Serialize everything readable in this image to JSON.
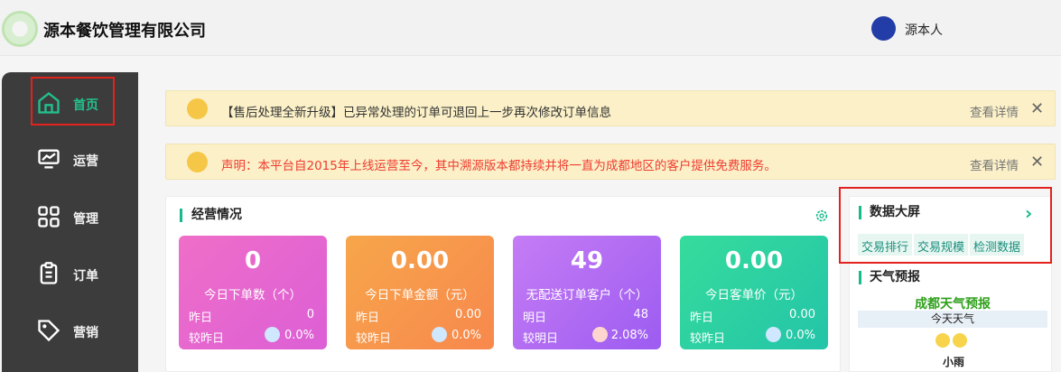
{
  "header": {
    "title": "源本餐饮管理有限公司",
    "user": "源本人"
  },
  "sidebar": {
    "items": [
      {
        "label": "首页",
        "icon": "home-icon",
        "active": true
      },
      {
        "label": "运营",
        "icon": "monitor-chart-icon"
      },
      {
        "label": "管理",
        "icon": "grid-icon"
      },
      {
        "label": "订单",
        "icon": "clipboard-icon"
      },
      {
        "label": "营销",
        "icon": "tag-icon"
      }
    ]
  },
  "notices": [
    {
      "text": "【售后处理全新升级】已异常处理的订单可退回上一步再次修改订单信息",
      "more": "查看详情",
      "close": "✕"
    },
    {
      "text": "声明：本平台自2015年上线运营至今，其中溯源版本都持续并将一直为成都地区的客户提供免费服务。",
      "more": "查看详情",
      "close": "✕"
    }
  ],
  "business": {
    "title": "经营情况",
    "cards": [
      {
        "value": "0",
        "label": "今日下单数（个）",
        "row1_label": "昨日",
        "row1_value": "0",
        "row2_label": "较昨日",
        "row2_value": "0.0%"
      },
      {
        "value": "0.00",
        "label": "今日下单金额（元）",
        "row1_label": "昨日",
        "row1_value": "0.00",
        "row2_label": "较昨日",
        "row2_value": "0.0%"
      },
      {
        "value": "49",
        "label": "无配送订单客户（个）",
        "row1_label": "明日",
        "row1_value": "48",
        "row2_label": "较明日",
        "row2_value": "2.08%"
      },
      {
        "value": "0.00",
        "label": "今日客单价（元）",
        "row1_label": "昨日",
        "row1_value": "0.00",
        "row2_label": "较昨日",
        "row2_value": "0.0%"
      }
    ]
  },
  "data_screen": {
    "title": "数据大屏",
    "tags": [
      "交易排行",
      "交易规模",
      "检测数据"
    ]
  },
  "weather": {
    "title": "天气预报",
    "city": "成都天气预报",
    "today": "今天天气",
    "desc": "小雨"
  }
}
